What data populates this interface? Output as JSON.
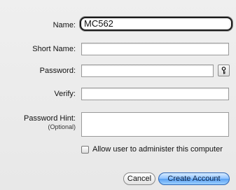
{
  "form": {
    "name": {
      "label": "Name:",
      "value": "MC562"
    },
    "short_name": {
      "label": "Short Name:",
      "value": ""
    },
    "password": {
      "label": "Password:",
      "value": ""
    },
    "verify": {
      "label": "Verify:",
      "value": ""
    },
    "password_hint": {
      "label": "Password Hint:",
      "note": "(Optional)",
      "value": ""
    },
    "admin_checkbox": {
      "label": "Allow user to administer this computer",
      "checked": false
    }
  },
  "buttons": {
    "cancel": "Cancel",
    "create": "Create Account"
  },
  "icons": {
    "password_assistant": "key-icon"
  },
  "colors": {
    "window_background": "#ececec",
    "default_button": "#5aa1f2"
  }
}
